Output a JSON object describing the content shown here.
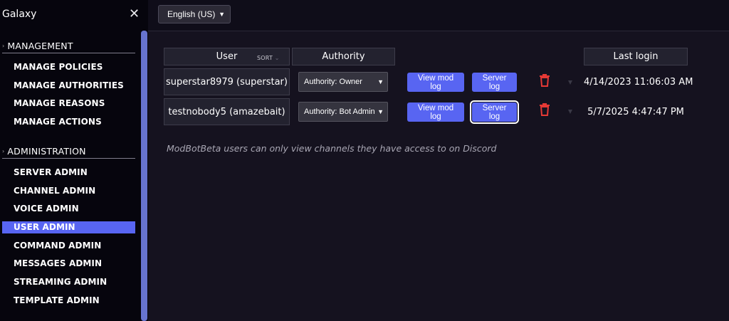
{
  "sidebar": {
    "title": "Galaxy",
    "close_icon": "close-icon",
    "sections": [
      {
        "label": "MANAGEMENT",
        "items": [
          "MANAGE POLICIES",
          "MANAGE AUTHORITIES",
          "MANAGE REASONS",
          "MANAGE ACTIONS"
        ]
      },
      {
        "label": "ADMINISTRATION",
        "items": [
          "SERVER ADMIN",
          "CHANNEL ADMIN",
          "VOICE ADMIN",
          "USER ADMIN",
          "COMMAND ADMIN",
          "MESSAGES ADMIN",
          "STREAMING ADMIN",
          "TEMPLATE ADMIN"
        ]
      }
    ],
    "active_item": "USER ADMIN"
  },
  "topbar": {
    "language": "English (US)"
  },
  "table": {
    "headers": {
      "user": "User",
      "sort": "SORT",
      "authority": "Authority",
      "last_login": "Last login"
    },
    "rows": [
      {
        "user": "superstar8979 (superstar)",
        "authority": "Authority: Owner",
        "view_mod_log": "View mod log",
        "server_log": "Server log",
        "last_login": "4/14/2023 11:06:03 AM"
      },
      {
        "user": "testnobody5 (amazebait)",
        "authority": "Authority: Bot Admin",
        "view_mod_log": "View mod log",
        "server_log": "Server log",
        "last_login": "5/7/2025 4:47:47 PM"
      }
    ]
  },
  "note": "ModBotBeta users can only view channels they have access to on Discord",
  "colors": {
    "accent": "#5865f2",
    "delete": "#e53935",
    "background": "#15121f",
    "sidebar": "#06050d"
  }
}
